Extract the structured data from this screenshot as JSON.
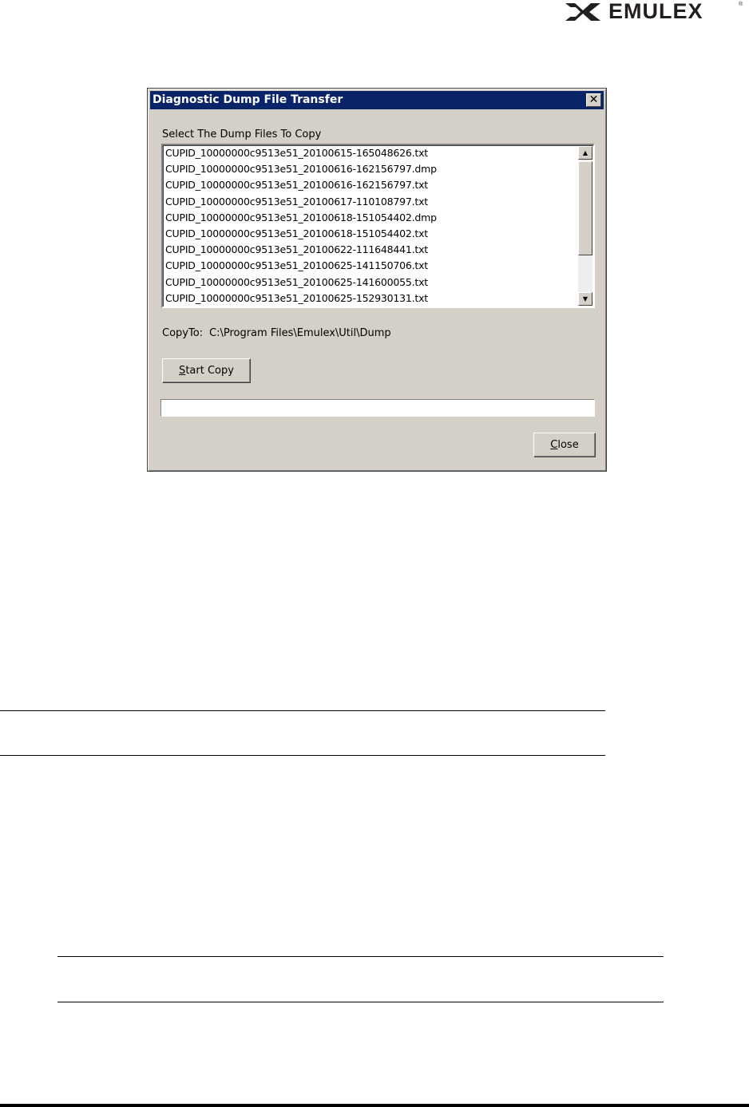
{
  "brand": {
    "logo_text": "EMULEX",
    "registered": "®"
  },
  "dialog": {
    "title": "Diagnostic Dump File Transfer",
    "close_glyph": "✕",
    "select_label": "Select The Dump Files To Copy",
    "files": [
      "CUPID_10000000c9513e51_20100615-165048626.txt",
      "CUPID_10000000c9513e51_20100616-162156797.dmp",
      "CUPID_10000000c9513e51_20100616-162156797.txt",
      "CUPID_10000000c9513e51_20100617-110108797.txt",
      "CUPID_10000000c9513e51_20100618-151054402.dmp",
      "CUPID_10000000c9513e51_20100618-151054402.txt",
      "CUPID_10000000c9513e51_20100622-111648441.txt",
      "CUPID_10000000c9513e51_20100625-141150706.txt",
      "CUPID_10000000c9513e51_20100625-141600055.txt",
      "CUPID_10000000c9513e51_20100625-152930131.txt"
    ],
    "copy_to_label": "CopyTo:",
    "copy_to_path": "C:\\Program Files\\Emulex\\Util\\Dump",
    "start_copy": {
      "mnemonic": "S",
      "rest": "tart Copy"
    },
    "close": {
      "mnemonic": "C",
      "rest": "lose"
    },
    "progress": 0
  }
}
